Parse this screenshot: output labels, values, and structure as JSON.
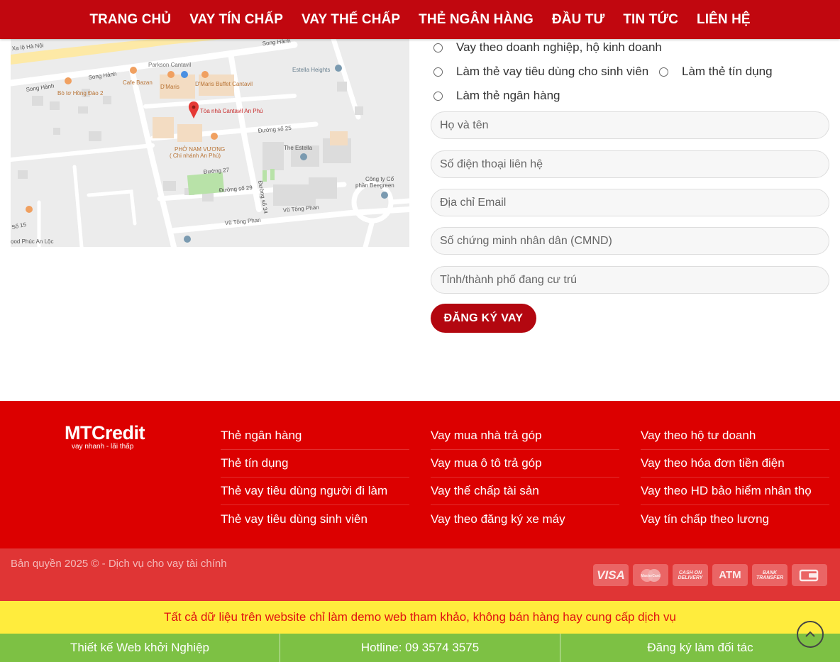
{
  "nav": {
    "items": [
      "TRANG CHỦ",
      "VAY TÍN CHẤP",
      "VAY THẾ CHẤP",
      "THẺ NGÂN HÀNG",
      "ĐẦU TƯ",
      "TIN TỨC",
      "LIÊN HỆ"
    ]
  },
  "map": {
    "labels": {
      "road1": "Xa lộ Hà Nội",
      "road2": "Song Hành",
      "road3": "Song Hành",
      "road4": "Song Hành",
      "parkson": "Parkson Cantavil",
      "cafe": "Cafe Bazan",
      "dmaris": "D'Maris",
      "buffet": "D'Maris Buffet Cantavil",
      "estella_heights": "Estella Heights",
      "bo_to": "Bò tơ Hồng Đào 2",
      "toa_nha": "Tòa nhà Cantavil An Phú",
      "duong25": "Đường số 25",
      "pho": "PHỞ NAM VƯƠNG",
      "pho_branch": "( Chi nhánh An Phú)",
      "the_estella": "The Estella",
      "duong27": "Đường 27",
      "duong29": "Đường số 29",
      "duong34": "Đường số 34",
      "congty": "Công ty Cổ",
      "congty2": "phần Beegreen",
      "vutong1": "Vũ Tông Phan",
      "vutong2": "Vũ Tông Phan",
      "so15": "Số 15",
      "phuc": "ọod Phúc An Lộc"
    }
  },
  "form": {
    "radios": [
      "Vay theo doanh nghiệp, hộ kinh doanh",
      "Làm thẻ vay tiêu dùng cho sinh viên",
      "Làm thẻ tín dụng",
      "Làm thẻ ngân hàng"
    ],
    "fields": [
      "Họ và tên",
      "Số điện thoại liên hệ",
      "Địa chỉ Email",
      "Số chứng minh nhân dân (CMND)",
      "Tỉnh/thành phố đang cư trú"
    ],
    "submit": "ĐĂNG KÝ VAY"
  },
  "footer": {
    "logo_name": "MTCredit",
    "logo_tagline": "vay nhanh - lãi thấp",
    "col1": [
      "Thẻ ngân hàng",
      "Thẻ tín dụng",
      "Thẻ vay tiêu dùng người đi làm",
      "Thẻ vay tiêu dùng sinh viên"
    ],
    "col2": [
      "Vay mua nhà trả góp",
      "Vay mua ô tô trả góp",
      "Vay thế chấp tài sản",
      "Vay theo đăng ký xe máy"
    ],
    "col3": [
      "Vay theo hộ tư doanh",
      "Vay theo hóa đơn tiền điện",
      "Vay theo HD bảo hiểm nhân thọ",
      "Vay tín chấp theo lương"
    ],
    "copyright": "Bản quyền 2025 © - Dịch vụ cho vay tài chính",
    "payments": [
      "VISA",
      "MasterCard",
      "CASH ON DELIVERY",
      "ATM",
      "BANK TRANSFER",
      "wallet-icon"
    ]
  },
  "notice": "Tất cả dữ liệu trên website chỉ làm demo web tham khảo, không bán hàng hay cung cấp dịch vụ",
  "bottombar": [
    "Thiết kế Web khởi Nghiệp",
    "Hotline: 09 3574 3575",
    "Đăng ký làm đối tác"
  ]
}
